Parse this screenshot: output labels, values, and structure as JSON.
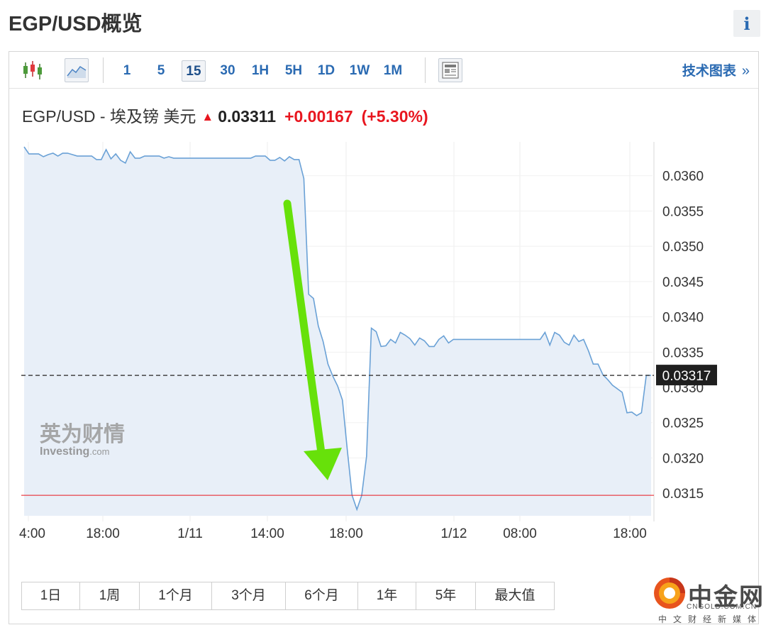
{
  "page": {
    "title": "EGP/USD概览",
    "info_label": "i"
  },
  "toolbar": {
    "timeframes": [
      "1",
      "5",
      "15",
      "30",
      "1H",
      "5H",
      "1D",
      "1W",
      "1M"
    ],
    "active_timeframe": "15",
    "tech_chart_label": "技术图表",
    "tech_chart_chevron": "»"
  },
  "quote": {
    "symbol": "EGP/USD - 埃及镑 美元",
    "arrow": "▲",
    "price": "0.03311",
    "change": "+0.00167",
    "change_pct": "(+5.30%)",
    "up_color": "#e8161f"
  },
  "chart_data": {
    "type": "area",
    "x_tick_labels": [
      "4:00",
      "18:00",
      "1/11",
      "14:00",
      "18:00",
      "1/12",
      "08:00",
      "18:00"
    ],
    "y_tick_labels": [
      "0.0360",
      "0.0355",
      "0.0350",
      "0.0345",
      "0.0340",
      "0.0335",
      "0.0330",
      "0.0325",
      "0.0320",
      "0.0315"
    ],
    "y_ticks": [
      0.036,
      0.0355,
      0.035,
      0.0345,
      0.034,
      0.0335,
      0.033,
      0.0325,
      0.032,
      0.0315
    ],
    "ylim": [
      0.03118,
      0.03648
    ],
    "series": [
      {
        "values": [
          0.03641,
          0.03631,
          0.03631,
          0.03631,
          0.03627,
          0.0363,
          0.03632,
          0.03628,
          0.03632,
          0.03632,
          0.0363,
          0.03628,
          0.03628,
          0.03628,
          0.03628,
          0.03623,
          0.03623,
          0.03637,
          0.03624,
          0.03631,
          0.03622,
          0.03618,
          0.03634,
          0.03625,
          0.03625,
          0.03628,
          0.03628,
          0.03628,
          0.03628,
          0.03625,
          0.03627,
          0.03625,
          0.03625,
          0.03625,
          0.03625,
          0.03625,
          0.03625,
          0.03625,
          0.03625,
          0.03625,
          0.03625,
          0.03625,
          0.03625,
          0.03625,
          0.03625,
          0.03625,
          0.03625,
          0.03625,
          0.03628,
          0.03628,
          0.03628,
          0.03622,
          0.03622,
          0.03626,
          0.03621,
          0.03627,
          0.03623,
          0.03623,
          0.03596,
          0.03432,
          0.03426,
          0.03387,
          0.03365,
          0.03333,
          0.03316,
          0.03302,
          0.03282,
          0.03212,
          0.03147,
          0.03127,
          0.03147,
          0.03202,
          0.03384,
          0.03379,
          0.03358,
          0.03359,
          0.03368,
          0.03363,
          0.03378,
          0.03374,
          0.03369,
          0.0336,
          0.0337,
          0.03366,
          0.03358,
          0.03358,
          0.03368,
          0.03373,
          0.03363,
          0.03368,
          0.03368,
          0.03368,
          0.03368,
          0.03368,
          0.03368,
          0.03368,
          0.03368,
          0.03368,
          0.03368,
          0.03368,
          0.03368,
          0.03368,
          0.03368,
          0.03368,
          0.03368,
          0.03368,
          0.03368,
          0.03368,
          0.03378,
          0.0336,
          0.03378,
          0.03374,
          0.03364,
          0.0336,
          0.03374,
          0.03365,
          0.03368,
          0.03352,
          0.03333,
          0.03333,
          0.03318,
          0.03311,
          0.03303,
          0.03298,
          0.03293,
          0.03264,
          0.03265,
          0.0326,
          0.03264,
          0.03317,
          0.03317
        ]
      }
    ],
    "current_price_label": "0.03317",
    "current_price": 0.03317,
    "reference_level": 0.03147,
    "line_color": "#6aa1d6",
    "fill_color": "#e8eff8",
    "reference_color": "#e8161f",
    "annotation_arrow_color": "#67e10a",
    "grid": "vertical"
  },
  "watermark": {
    "cn": "英为财情",
    "en": "Investing",
    "en_suffix": ".com"
  },
  "ranges": [
    "1日",
    "1周",
    "1个月",
    "3个月",
    "6个月",
    "1年",
    "5年",
    "最大值"
  ],
  "source_logo": {
    "name": "中金网",
    "url": "CNGOLD.COM.CN",
    "subtitle": "中文财经新媒体"
  }
}
